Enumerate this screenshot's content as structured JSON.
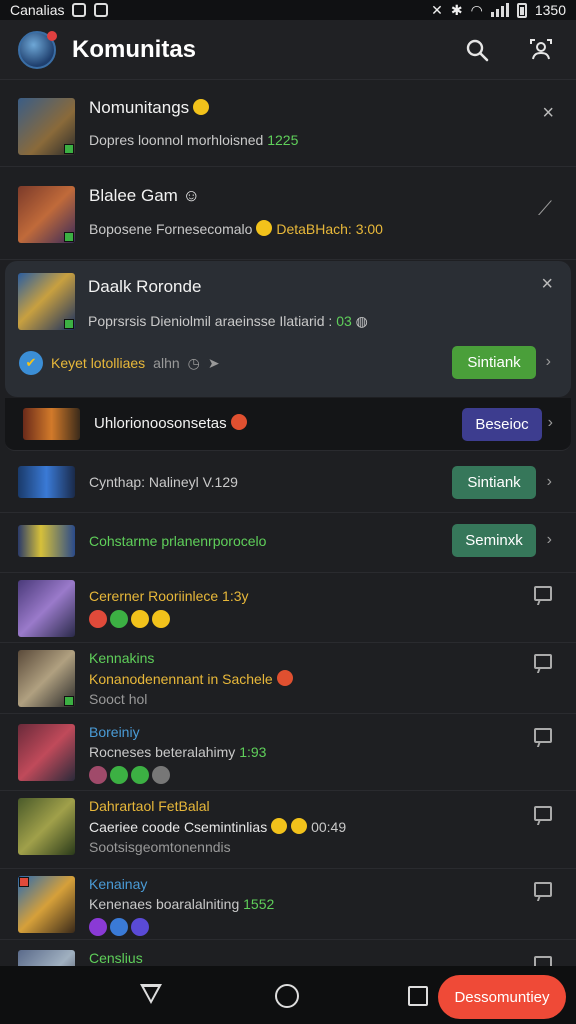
{
  "status_bar": {
    "carrier": "Canalias",
    "time": "1350"
  },
  "app_bar": {
    "title": "Komunitas"
  },
  "rows": [
    {
      "title": "Nomunitangs",
      "subtitle": "Dopres loonnol morhloisned",
      "meta": "1225"
    },
    {
      "title": "Blalee Gam",
      "subtitle": "Boposene Fornesecomalo",
      "highlight": "DetaBHach: 3:00"
    },
    {
      "title": "Daalk Roronde",
      "subtitle": "Poprsrsis Dieniolmil araeinsse Ilatiarid :",
      "meta": "03",
      "status_text": "Keyet lotolliaes",
      "status_after": "alhn",
      "button": "Sintiank"
    },
    {
      "title": "Uhlorionoosonsetas",
      "button": "Beseioc"
    },
    {
      "title": "Cynthap: Nalineyl V.129",
      "button": "Sintiank"
    },
    {
      "title": "Cohstarme prlanenrporocelo",
      "button": "Seminxk"
    },
    {
      "title": "Cererner Rooriinlece 1:3y"
    },
    {
      "title": "Kennakins",
      "line2": "Konanodenennant in Sachele",
      "line3": "Sooct hol"
    },
    {
      "title": "Boreiniy",
      "line2": "Rocneses beteralahimy",
      "meta": "1:93"
    },
    {
      "title": "Dahrartaol FetBalal",
      "line2": "Caeriee coode Csemintinlias",
      "time2": "00:49",
      "line3": "Sootsisgeomtonenndis"
    },
    {
      "title": "Kenainay",
      "line2": "Kenenaes boaralalniting",
      "meta": "1552"
    },
    {
      "title": "Censlius"
    }
  ],
  "fab_label": "Dessomuntiey",
  "colors": {
    "accent_green": "#4a9f3a",
    "accent_red": "#ef4a37",
    "highlight_yellow": "#e8b83a"
  }
}
